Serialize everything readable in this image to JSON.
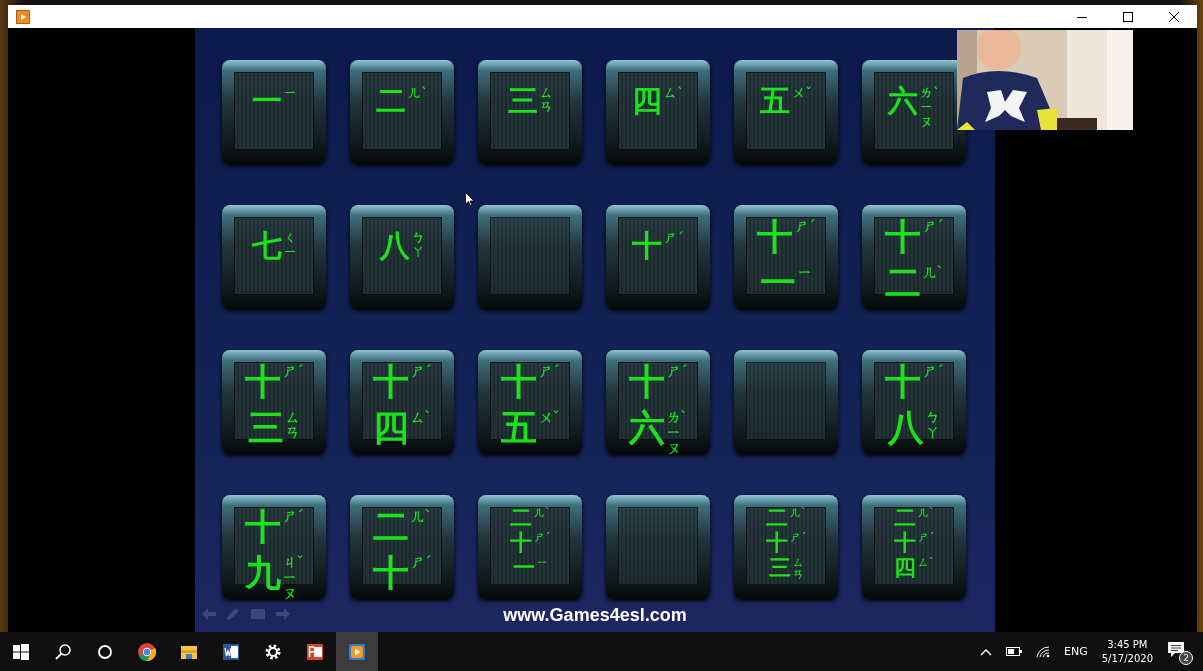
{
  "slide": {
    "tiles": [
      {
        "kind": "card",
        "lines": [
          {
            "char": "一",
            "zhuyin": "ㄧ"
          }
        ]
      },
      {
        "kind": "card",
        "lines": [
          {
            "char": "二",
            "zhuyin": "ㄦ",
            "tone": "ˋ"
          }
        ]
      },
      {
        "kind": "card",
        "lines": [
          {
            "char": "三",
            "zhuyin": "ㄙㄢ"
          }
        ]
      },
      {
        "kind": "card",
        "lines": [
          {
            "char": "四",
            "zhuyin": "ㄙ",
            "tone": "ˋ"
          }
        ]
      },
      {
        "kind": "card",
        "lines": [
          {
            "char": "五",
            "zhuyin": "ㄨ",
            "tone": "ˇ"
          }
        ]
      },
      {
        "kind": "card",
        "lines": [
          {
            "char": "六",
            "zhuyin": "ㄌㄧㄡ",
            "tone": "ˋ"
          }
        ]
      },
      {
        "kind": "card",
        "lines": [
          {
            "char": "七",
            "zhuyin": "ㄑㄧ"
          }
        ]
      },
      {
        "kind": "card",
        "lines": [
          {
            "char": "八",
            "zhuyin": "ㄅㄚ"
          }
        ]
      },
      {
        "kind": "blank"
      },
      {
        "kind": "card",
        "lines": [
          {
            "char": "十",
            "zhuyin": "ㄕ",
            "tone": "ˊ"
          }
        ]
      },
      {
        "kind": "card",
        "lines": [
          {
            "char": "十",
            "zhuyin": "ㄕ",
            "tone": "ˊ"
          },
          {
            "char": "一",
            "zhuyin": "ㄧ"
          }
        ]
      },
      {
        "kind": "card",
        "lines": [
          {
            "char": "十",
            "zhuyin": "ㄕ",
            "tone": "ˊ"
          },
          {
            "char": "二",
            "zhuyin": "ㄦ",
            "tone": "ˋ"
          }
        ]
      },
      {
        "kind": "card",
        "lines": [
          {
            "char": "十",
            "zhuyin": "ㄕ",
            "tone": "ˊ"
          },
          {
            "char": "三",
            "zhuyin": "ㄙㄢ"
          }
        ]
      },
      {
        "kind": "card",
        "lines": [
          {
            "char": "十",
            "zhuyin": "ㄕ",
            "tone": "ˊ"
          },
          {
            "char": "四",
            "zhuyin": "ㄙ",
            "tone": "ˋ"
          }
        ]
      },
      {
        "kind": "card",
        "lines": [
          {
            "char": "十",
            "zhuyin": "ㄕ",
            "tone": "ˊ"
          },
          {
            "char": "五",
            "zhuyin": "ㄨ",
            "tone": "ˇ"
          }
        ]
      },
      {
        "kind": "card",
        "lines": [
          {
            "char": "十",
            "zhuyin": "ㄕ",
            "tone": "ˊ"
          },
          {
            "char": "六",
            "zhuyin": "ㄌㄧㄡ",
            "tone": "ˋ"
          }
        ]
      },
      {
        "kind": "blank"
      },
      {
        "kind": "card",
        "lines": [
          {
            "char": "十",
            "zhuyin": "ㄕ",
            "tone": "ˊ"
          },
          {
            "char": "八",
            "zhuyin": "ㄅㄚ"
          }
        ]
      },
      {
        "kind": "card",
        "lines": [
          {
            "char": "十",
            "zhuyin": "ㄕ",
            "tone": "ˊ"
          },
          {
            "char": "九",
            "zhuyin": "ㄐㄧㄡ",
            "tone": "ˇ"
          }
        ]
      },
      {
        "kind": "card",
        "lines": [
          {
            "char": "二",
            "zhuyin": "ㄦ",
            "tone": "ˋ"
          },
          {
            "char": "十",
            "zhuyin": "ㄕ",
            "tone": "ˊ"
          }
        ]
      },
      {
        "kind": "card",
        "lines": [
          {
            "char": "二",
            "zhuyin": "ㄦ",
            "tone": "ˋ"
          },
          {
            "char": "十",
            "zhuyin": "ㄕ",
            "tone": "ˊ"
          },
          {
            "char": "一",
            "zhuyin": "ㄧ"
          }
        ]
      },
      {
        "kind": "blank"
      },
      {
        "kind": "card",
        "lines": [
          {
            "char": "二",
            "zhuyin": "ㄦ",
            "tone": "ˋ"
          },
          {
            "char": "十",
            "zhuyin": "ㄕ",
            "tone": "ˊ"
          },
          {
            "char": "三",
            "zhuyin": "ㄙㄢ"
          }
        ]
      },
      {
        "kind": "card",
        "lines": [
          {
            "char": "二",
            "zhuyin": "ㄦ",
            "tone": "ˋ"
          },
          {
            "char": "十",
            "zhuyin": "ㄕ",
            "tone": "ˊ"
          },
          {
            "char": "四",
            "zhuyin": "ㄙ",
            "tone": "ˋ"
          }
        ]
      }
    ],
    "website": "www.Games4esl.com"
  },
  "taskbar": {
    "apps": [
      {
        "kind": "start",
        "selected": false
      },
      {
        "kind": "search",
        "selected": false
      },
      {
        "kind": "cortana",
        "selected": false
      },
      {
        "kind": "chrome",
        "selected": false
      },
      {
        "kind": "explorer",
        "selected": false
      },
      {
        "kind": "word",
        "selected": false
      },
      {
        "kind": "settings",
        "selected": false
      },
      {
        "kind": "powerpoint",
        "selected": false
      },
      {
        "kind": "player",
        "selected": true
      }
    ],
    "tray": {
      "language": "ENG",
      "time": "3:45 PM",
      "date": "5/17/2020",
      "notifications": "2"
    }
  }
}
